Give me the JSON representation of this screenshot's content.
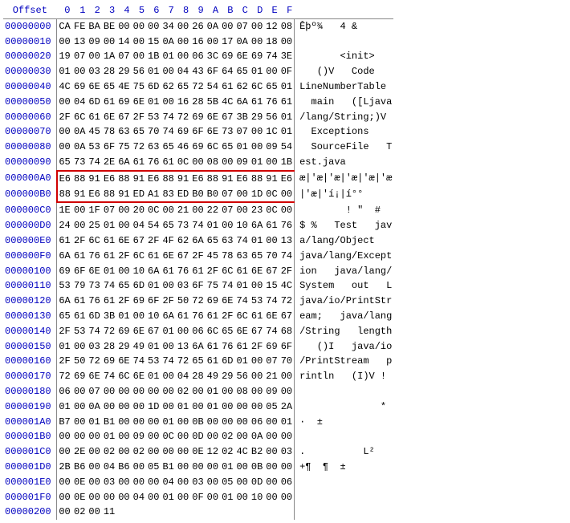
{
  "offset_label": "Offset",
  "cols": [
    "0",
    "1",
    "2",
    "3",
    "4",
    "5",
    "6",
    "7",
    "8",
    "9",
    "A",
    "B",
    "C",
    "D",
    "E",
    "F"
  ],
  "rows": [
    {
      "offset": "00000000",
      "hex": [
        "CA",
        "FE",
        "BA",
        "BE",
        "00",
        "00",
        "00",
        "34",
        "00",
        "26",
        "0A",
        "00",
        "07",
        "00",
        "12",
        "08"
      ],
      "ascii": "Êþº¾   4 &",
      "hl": false
    },
    {
      "offset": "00000010",
      "hex": [
        "00",
        "13",
        "09",
        "00",
        "14",
        "00",
        "15",
        "0A",
        "00",
        "16",
        "00",
        "17",
        "0A",
        "00",
        "18",
        "00"
      ],
      "ascii": "",
      "hl": false
    },
    {
      "offset": "00000020",
      "hex": [
        "19",
        "07",
        "00",
        "1A",
        "07",
        "00",
        "1B",
        "01",
        "00",
        "06",
        "3C",
        "69",
        "6E",
        "69",
        "74",
        "3E"
      ],
      "ascii": "       <init>",
      "hl": false
    },
    {
      "offset": "00000030",
      "hex": [
        "01",
        "00",
        "03",
        "28",
        "29",
        "56",
        "01",
        "00",
        "04",
        "43",
        "6F",
        "64",
        "65",
        "01",
        "00",
        "0F"
      ],
      "ascii": "   ()V   Code",
      "hl": false
    },
    {
      "offset": "00000040",
      "hex": [
        "4C",
        "69",
        "6E",
        "65",
        "4E",
        "75",
        "6D",
        "62",
        "65",
        "72",
        "54",
        "61",
        "62",
        "6C",
        "65",
        "01"
      ],
      "ascii": "LineNumberTable",
      "hl": false
    },
    {
      "offset": "00000050",
      "hex": [
        "00",
        "04",
        "6D",
        "61",
        "69",
        "6E",
        "01",
        "00",
        "16",
        "28",
        "5B",
        "4C",
        "6A",
        "61",
        "76",
        "61"
      ],
      "ascii": "  main   ([Ljava",
      "hl": false
    },
    {
      "offset": "00000060",
      "hex": [
        "2F",
        "6C",
        "61",
        "6E",
        "67",
        "2F",
        "53",
        "74",
        "72",
        "69",
        "6E",
        "67",
        "3B",
        "29",
        "56",
        "01"
      ],
      "ascii": "/lang/String;)V",
      "hl": false
    },
    {
      "offset": "00000070",
      "hex": [
        "00",
        "0A",
        "45",
        "78",
        "63",
        "65",
        "70",
        "74",
        "69",
        "6F",
        "6E",
        "73",
        "07",
        "00",
        "1C",
        "01"
      ],
      "ascii": "  Exceptions",
      "hl": false
    },
    {
      "offset": "00000080",
      "hex": [
        "00",
        "0A",
        "53",
        "6F",
        "75",
        "72",
        "63",
        "65",
        "46",
        "69",
        "6C",
        "65",
        "01",
        "00",
        "09",
        "54"
      ],
      "ascii": "  SourceFile   T",
      "hl": false
    },
    {
      "offset": "00000090",
      "hex": [
        "65",
        "73",
        "74",
        "2E",
        "6A",
        "61",
        "76",
        "61",
        "0C",
        "00",
        "08",
        "00",
        "09",
        "01",
        "00",
        "1B"
      ],
      "ascii": "est.java",
      "hl": false
    },
    {
      "offset": "000000A0",
      "hex": [
        "E6",
        "88",
        "91",
        "E6",
        "88",
        "91",
        "E6",
        "88",
        "91",
        "E6",
        "88",
        "91",
        "E6",
        "88",
        "91",
        "E6"
      ],
      "ascii": "æ|'æ|'æ|'æ|'æ|'æ",
      "hl": true
    },
    {
      "offset": "000000B0",
      "hex": [
        "88",
        "91",
        "E6",
        "88",
        "91",
        "ED",
        "A1",
        "83",
        "ED",
        "B0",
        "B0",
        "07",
        "00",
        "1D",
        "0C",
        "00"
      ],
      "ascii": "|'æ|'í¡|í°°",
      "hl": true
    },
    {
      "offset": "000000C0",
      "hex": [
        "1E",
        "00",
        "1F",
        "07",
        "00",
        "20",
        "0C",
        "00",
        "21",
        "00",
        "22",
        "07",
        "00",
        "23",
        "0C",
        "00"
      ],
      "ascii": "        ! \"  #",
      "hl": false
    },
    {
      "offset": "000000D0",
      "hex": [
        "24",
        "00",
        "25",
        "01",
        "00",
        "04",
        "54",
        "65",
        "73",
        "74",
        "01",
        "00",
        "10",
        "6A",
        "61",
        "76"
      ],
      "ascii": "$ %   Test   jav",
      "hl": false
    },
    {
      "offset": "000000E0",
      "hex": [
        "61",
        "2F",
        "6C",
        "61",
        "6E",
        "67",
        "2F",
        "4F",
        "62",
        "6A",
        "65",
        "63",
        "74",
        "01",
        "00",
        "13"
      ],
      "ascii": "a/lang/Object",
      "hl": false
    },
    {
      "offset": "000000F0",
      "hex": [
        "6A",
        "61",
        "76",
        "61",
        "2F",
        "6C",
        "61",
        "6E",
        "67",
        "2F",
        "45",
        "78",
        "63",
        "65",
        "70",
        "74"
      ],
      "ascii": "java/lang/Except",
      "hl": false
    },
    {
      "offset": "00000100",
      "hex": [
        "69",
        "6F",
        "6E",
        "01",
        "00",
        "10",
        "6A",
        "61",
        "76",
        "61",
        "2F",
        "6C",
        "61",
        "6E",
        "67",
        "2F"
      ],
      "ascii": "ion   java/lang/",
      "hl": false
    },
    {
      "offset": "00000110",
      "hex": [
        "53",
        "79",
        "73",
        "74",
        "65",
        "6D",
        "01",
        "00",
        "03",
        "6F",
        "75",
        "74",
        "01",
        "00",
        "15",
        "4C"
      ],
      "ascii": "System   out   L",
      "hl": false
    },
    {
      "offset": "00000120",
      "hex": [
        "6A",
        "61",
        "76",
        "61",
        "2F",
        "69",
        "6F",
        "2F",
        "50",
        "72",
        "69",
        "6E",
        "74",
        "53",
        "74",
        "72"
      ],
      "ascii": "java/io/PrintStr",
      "hl": false
    },
    {
      "offset": "00000130",
      "hex": [
        "65",
        "61",
        "6D",
        "3B",
        "01",
        "00",
        "10",
        "6A",
        "61",
        "76",
        "61",
        "2F",
        "6C",
        "61",
        "6E",
        "67"
      ],
      "ascii": "eam;   java/lang",
      "hl": false
    },
    {
      "offset": "00000140",
      "hex": [
        "2F",
        "53",
        "74",
        "72",
        "69",
        "6E",
        "67",
        "01",
        "00",
        "06",
        "6C",
        "65",
        "6E",
        "67",
        "74",
        "68"
      ],
      "ascii": "/String   length",
      "hl": false
    },
    {
      "offset": "00000150",
      "hex": [
        "01",
        "00",
        "03",
        "28",
        "29",
        "49",
        "01",
        "00",
        "13",
        "6A",
        "61",
        "76",
        "61",
        "2F",
        "69",
        "6F"
      ],
      "ascii": "   ()I   java/io",
      "hl": false
    },
    {
      "offset": "00000160",
      "hex": [
        "2F",
        "50",
        "72",
        "69",
        "6E",
        "74",
        "53",
        "74",
        "72",
        "65",
        "61",
        "6D",
        "01",
        "00",
        "07",
        "70"
      ],
      "ascii": "/PrintStream   p",
      "hl": false
    },
    {
      "offset": "00000170",
      "hex": [
        "72",
        "69",
        "6E",
        "74",
        "6C",
        "6E",
        "01",
        "00",
        "04",
        "28",
        "49",
        "29",
        "56",
        "00",
        "21",
        "00"
      ],
      "ascii": "rintln   (I)V !",
      "hl": false
    },
    {
      "offset": "00000180",
      "hex": [
        "06",
        "00",
        "07",
        "00",
        "00",
        "00",
        "00",
        "00",
        "02",
        "00",
        "01",
        "00",
        "08",
        "00",
        "09",
        "00"
      ],
      "ascii": "",
      "hl": false
    },
    {
      "offset": "00000190",
      "hex": [
        "01",
        "00",
        "0A",
        "00",
        "00",
        "00",
        "1D",
        "00",
        "01",
        "00",
        "01",
        "00",
        "00",
        "00",
        "05",
        "2A"
      ],
      "ascii": "              *",
      "hl": false
    },
    {
      "offset": "000001A0",
      "hex": [
        "B7",
        "00",
        "01",
        "B1",
        "00",
        "00",
        "00",
        "01",
        "00",
        "0B",
        "00",
        "00",
        "00",
        "06",
        "00",
        "01"
      ],
      "ascii": "·  ±",
      "hl": false
    },
    {
      "offset": "000001B0",
      "hex": [
        "00",
        "00",
        "00",
        "01",
        "00",
        "09",
        "00",
        "0C",
        "00",
        "0D",
        "00",
        "02",
        "00",
        "0A",
        "00",
        "00"
      ],
      "ascii": "",
      "hl": false
    },
    {
      "offset": "000001C0",
      "hex": [
        "00",
        "2E",
        "00",
        "02",
        "00",
        "02",
        "00",
        "00",
        "00",
        "0E",
        "12",
        "02",
        "4C",
        "B2",
        "00",
        "03"
      ],
      "ascii": ".          L²",
      "hl": false
    },
    {
      "offset": "000001D0",
      "hex": [
        "2B",
        "B6",
        "00",
        "04",
        "B6",
        "00",
        "05",
        "B1",
        "00",
        "00",
        "00",
        "01",
        "00",
        "0B",
        "00",
        "00"
      ],
      "ascii": "+¶  ¶  ±",
      "hl": false
    },
    {
      "offset": "000001E0",
      "hex": [
        "00",
        "0E",
        "00",
        "03",
        "00",
        "00",
        "00",
        "04",
        "00",
        "03",
        "00",
        "05",
        "00",
        "0D",
        "00",
        "06"
      ],
      "ascii": "",
      "hl": false
    },
    {
      "offset": "000001F0",
      "hex": [
        "00",
        "0E",
        "00",
        "00",
        "00",
        "04",
        "00",
        "01",
        "00",
        "0F",
        "00",
        "01",
        "00",
        "10",
        "00",
        "00"
      ],
      "ascii": "",
      "hl": false
    },
    {
      "offset": "00000200",
      "hex": [
        "00",
        "02",
        "00",
        "11"
      ],
      "ascii": "",
      "hl": false
    }
  ]
}
